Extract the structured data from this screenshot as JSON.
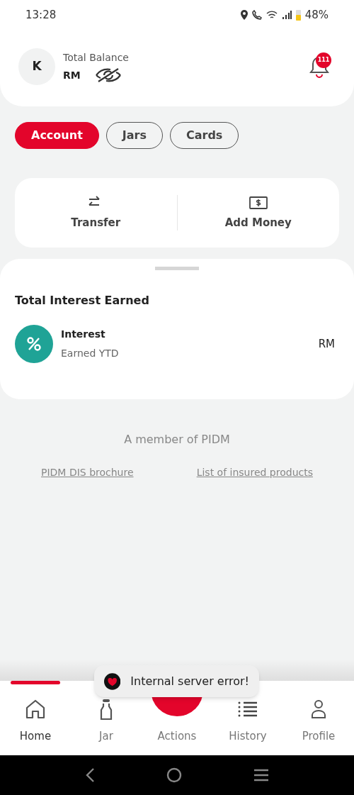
{
  "status_bar": {
    "time": "13:28",
    "battery": "48%"
  },
  "header": {
    "avatar_initial": "K",
    "balance_label": "Total Balance",
    "currency": "RM",
    "balance_hidden": true,
    "notification_count": "111"
  },
  "tabs": [
    {
      "label": "Account",
      "selected": true
    },
    {
      "label": "Jars",
      "selected": false
    },
    {
      "label": "Cards",
      "selected": false
    }
  ],
  "quick_actions": [
    {
      "kind": "transfer",
      "label": "Transfer"
    },
    {
      "kind": "add",
      "label": "Add Money"
    }
  ],
  "interest_section": {
    "title": "Total Interest Earned",
    "item": {
      "title": "Interest",
      "subtitle": "Earned YTD",
      "amount": "RM"
    }
  },
  "footer": {
    "member_text": "A member of PIDM",
    "links": [
      "PIDM DIS brochure",
      "List of insured products"
    ]
  },
  "toast": {
    "message": "Internal server error!"
  },
  "bottom_nav": [
    {
      "kind": "home",
      "label": "Home",
      "selected": true
    },
    {
      "kind": "jar",
      "label": "Jar",
      "selected": false
    },
    {
      "kind": "actions",
      "label": "Actions",
      "selected": false
    },
    {
      "kind": "history",
      "label": "History",
      "selected": false
    },
    {
      "kind": "profile",
      "label": "Profile",
      "selected": false
    }
  ]
}
